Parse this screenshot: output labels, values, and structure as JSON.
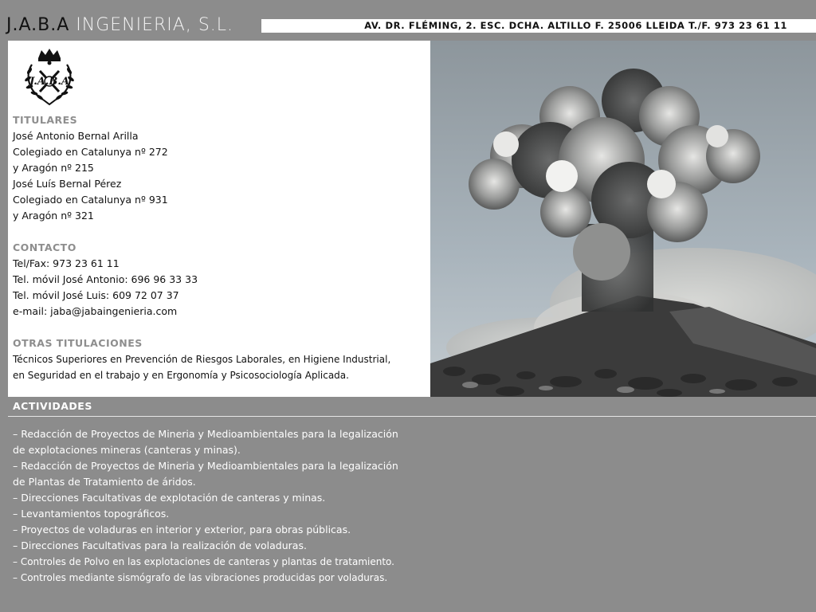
{
  "header": {
    "brand": "J.A.B.A",
    "company": "INGENIERIA, S.L.",
    "address": "AV. DR. FLÉMING, 2.   ESC. DCHA.   ALTILLO F.   25006 LLEIDA   T./F. 973 23 61 11"
  },
  "logo": {
    "text": "J.A.B.A"
  },
  "titulares": {
    "heading": "TITULARES",
    "lines": [
      "José Antonio Bernal Arilla",
      "Colegiado en Catalunya nº 272",
      "y Aragón nº 215",
      "José Luís Bernal Pérez",
      "Colegiado en Catalunya nº 931",
      "y Aragón nº 321"
    ]
  },
  "contacto": {
    "heading": "CONTACTO",
    "lines": [
      "Tel/Fax: 973 23 61 11",
      "Tel. móvil José Antonio: 696 96 33 33",
      "Tel. móvil José Luis: 609 72 07 37",
      "e-mail: jaba@jabaingenieria.com"
    ]
  },
  "otras": {
    "heading": "OTRAS TITULACIONES",
    "lines": [
      "Técnicos Superiores en Prevención de Riesgos Laborales, en Higiene Industrial,",
      "en Seguridad en el trabajo y en Ergonomía y Psicosociología Aplicada."
    ]
  },
  "actividades": {
    "heading": "ACTIVIDADES",
    "lines": [
      "– Redacción de Proyectos de Mineria y Medioambientales para la legalización",
      "de explotaciones mineras (canteras y minas).",
      "– Redacción de Proyectos de Mineria y Medioambientales para la legalización",
      "de Plantas de Tratamiento de áridos.",
      "– Direcciones Facultativas de explotación de canteras y minas.",
      "– Levantamientos topográficos.",
      "– Proyectos de voladuras en interior y exterior, para obras públicas.",
      "– Direcciones Facultativas para la realización de voladuras.",
      "– Controles de Polvo en las explotaciones de canteras y plantas de tratamiento.",
      "– Controles mediante sismógrafo de las vibraciones producidas por voladuras."
    ]
  },
  "colors": {
    "background": "#8c8c8c",
    "panel": "#ffffff",
    "section_heading": "#8e8e8e",
    "text_dark": "#111111",
    "text_light": "#ffffff"
  },
  "icons": [
    "crest-logo",
    "eruption-photo"
  ]
}
